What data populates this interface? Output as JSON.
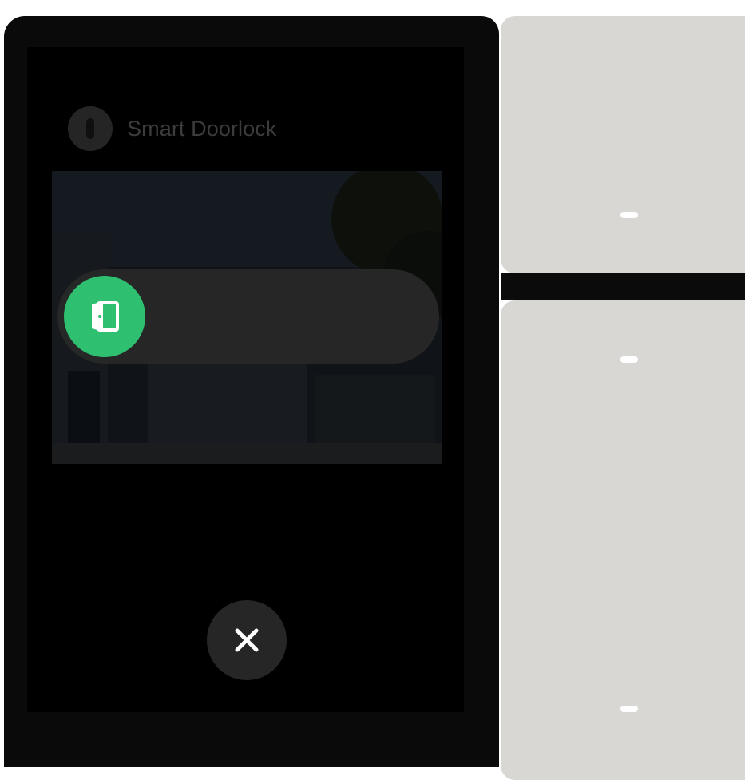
{
  "app": {
    "title": "Smart Doorlock",
    "icon": "doorlock-icon"
  },
  "unlock": {
    "icon": "door-open-icon",
    "color": "#2fbf71"
  },
  "controls": {
    "close_icon": "close-icon"
  },
  "switches": {
    "indicator_icons": [
      "indicator-led-icon",
      "indicator-led-icon",
      "indicator-led-icon"
    ]
  }
}
